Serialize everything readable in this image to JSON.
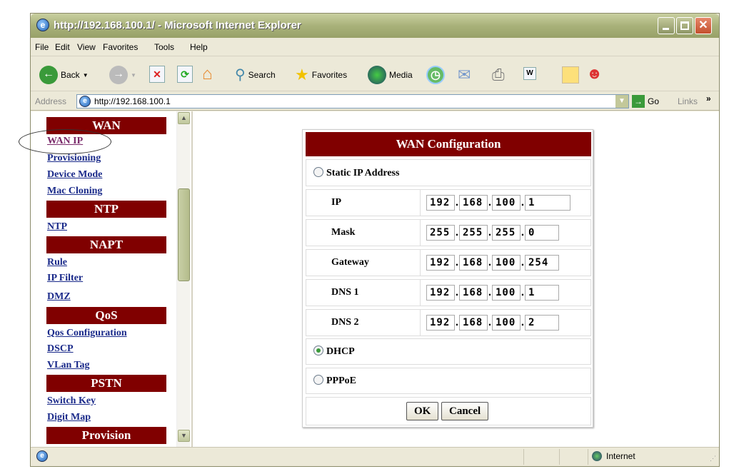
{
  "window": {
    "title": "http://192.168.100.1/ - Microsoft Internet Explorer"
  },
  "menu": [
    "File",
    "Edit",
    "View",
    "Favorites",
    "Tools",
    "Help"
  ],
  "toolbar": {
    "back": "Back",
    "search": "Search",
    "favorites": "Favorites",
    "media": "Media"
  },
  "address": {
    "label": "Address",
    "url": "http://192.168.100.1",
    "go": "Go",
    "links": "Links"
  },
  "sidebar": {
    "sections": [
      {
        "title": "WAN",
        "links": [
          "WAN IP",
          "Provisioning",
          "Device Mode",
          "Mac Cloning"
        ]
      },
      {
        "title": "NTP",
        "links": [
          "NTP"
        ]
      },
      {
        "title": "NAPT",
        "links": [
          "Rule",
          "IP Filter",
          "DMZ"
        ]
      },
      {
        "title": "QoS",
        "links": [
          "Qos Configuration",
          "DSCP",
          "VLan Tag"
        ]
      },
      {
        "title": "PSTN",
        "links": [
          "Switch Key",
          "Digit Map"
        ]
      },
      {
        "title": "Provision",
        "links": []
      }
    ],
    "highlighted": "WAN IP"
  },
  "form": {
    "title": "WAN Configuration",
    "static_label": "Static IP Address",
    "fields": [
      {
        "label": "IP",
        "value": [
          "192",
          "168",
          "100",
          "1"
        ]
      },
      {
        "label": "Mask",
        "value": [
          "255",
          "255",
          "255",
          "0"
        ]
      },
      {
        "label": "Gateway",
        "value": [
          "192",
          "168",
          "100",
          "254"
        ]
      },
      {
        "label": "DNS 1",
        "value": [
          "192",
          "168",
          "100",
          "1"
        ]
      },
      {
        "label": "DNS 2",
        "value": [
          "192",
          "168",
          "100",
          "2"
        ]
      }
    ],
    "dhcp_label": "DHCP",
    "pppoe_label": "PPPoE",
    "selected_mode": "DHCP",
    "ok": "OK",
    "cancel": "Cancel"
  },
  "status": {
    "zone": "Internet"
  },
  "colors": {
    "header": "#800000",
    "link": "#1a2a8a",
    "titlebar": "#a9b27a"
  }
}
